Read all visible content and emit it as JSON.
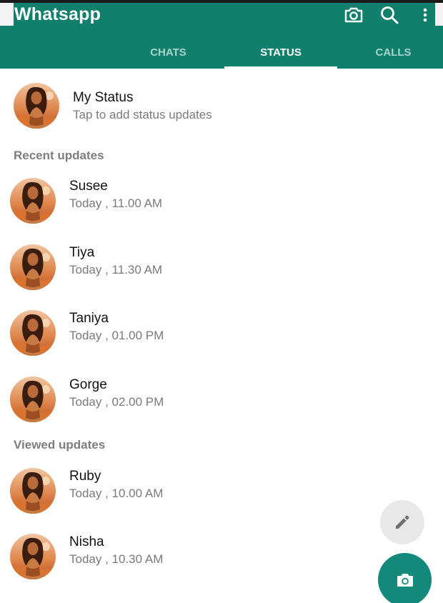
{
  "header": {
    "title": "Whatsapp",
    "icons": [
      "camera-icon",
      "search-icon",
      "more-vertical-icon"
    ],
    "tabs": [
      {
        "label": "CHATS",
        "active": false
      },
      {
        "label": "STATUS",
        "active": true
      },
      {
        "label": "CALLS",
        "active": false
      }
    ]
  },
  "my_status": {
    "name": "My Status",
    "subtitle": "Tap to add status updates"
  },
  "recent": {
    "label": "Recent updates",
    "items": [
      {
        "name": "Susee",
        "time": "Today , 11.00 AM"
      },
      {
        "name": "Tiya",
        "time": "Today , 11.30 AM"
      },
      {
        "name": "Taniya",
        "time": "Today , 01.00 PM"
      },
      {
        "name": "Gorge",
        "time": "Today , 02.00 PM"
      }
    ]
  },
  "viewed": {
    "label": "Viewed updates",
    "items": [
      {
        "name": "Ruby",
        "time": "Today , 10.00 AM"
      },
      {
        "name": "Nisha",
        "time": "Today , 10.30 AM"
      }
    ]
  },
  "fabs": [
    "pencil-icon",
    "camera-icon"
  ],
  "colors": {
    "primary": "#10806c",
    "tab_inactive": "#a9d3cb",
    "fab_camera": "#12897b",
    "fab_edit": "#e8e8e8",
    "subtitle": "#7a7a7a"
  }
}
